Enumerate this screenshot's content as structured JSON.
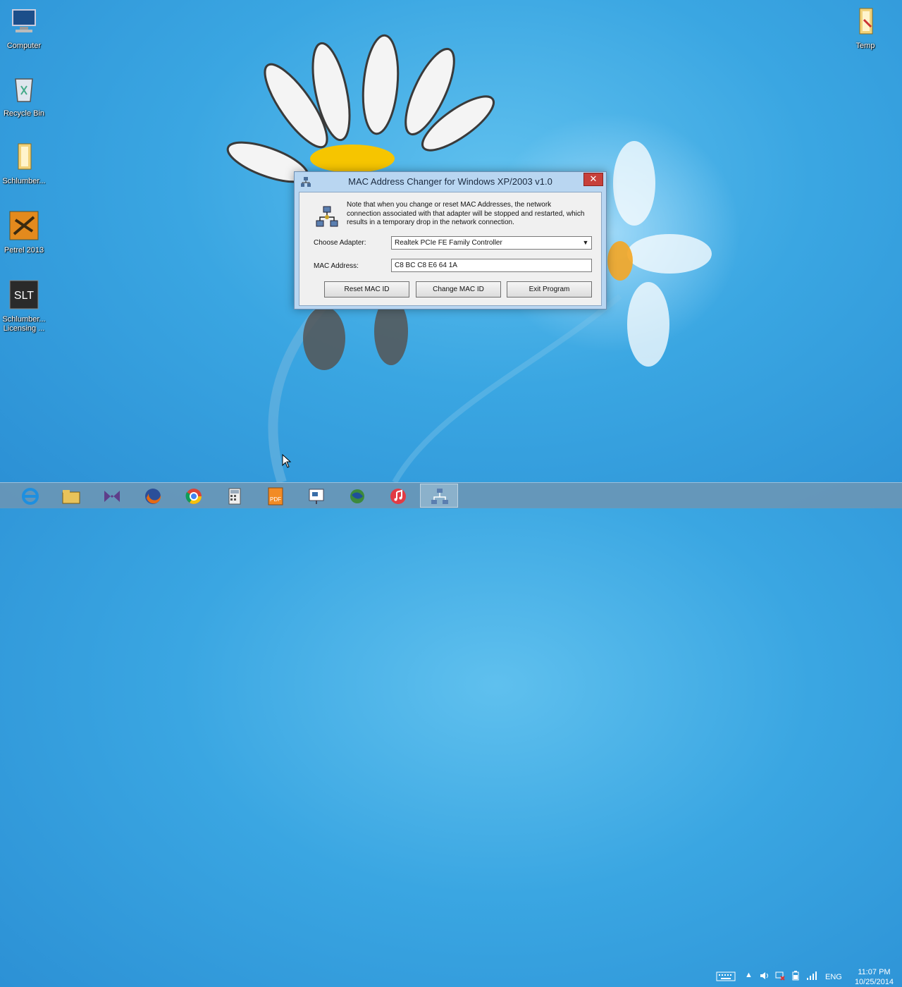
{
  "desktop": {
    "icons_left": [
      {
        "label": "Computer",
        "icon": "computer-icon"
      },
      {
        "label": "Recycle Bin",
        "icon": "recycle-bin-icon"
      },
      {
        "label": "Schlumber...",
        "icon": "folder-icon"
      },
      {
        "label": "Petrel 2013",
        "icon": "petrel-icon"
      },
      {
        "label": "Schlumber... Licensing ...",
        "icon": "slt-icon"
      }
    ],
    "icon_right": {
      "label": "Temp",
      "icon": "folder-icon"
    }
  },
  "dialog": {
    "title": "MAC Address Changer for Windows XP/2003 v1.0",
    "close_label": "✕",
    "note": "Note that when you change or reset MAC Addresses, the network connection associated with that adapter will be stopped and restarted, which results in a temporary drop in the network connection.",
    "adapter_label": "Choose Adapter:",
    "adapter_value": "Realtek PCIe FE Family Controller",
    "mac_label": "MAC Address:",
    "mac_value": "C8 BC C8 E6 64 1A",
    "buttons": {
      "reset": "Reset MAC ID",
      "change": "Change MAC ID",
      "exit": "Exit Program"
    }
  },
  "taskbar": {
    "items": [
      {
        "name": "internet-explorer-icon"
      },
      {
        "name": "file-explorer-icon"
      },
      {
        "name": "visual-studio-icon"
      },
      {
        "name": "firefox-icon"
      },
      {
        "name": "chrome-icon"
      },
      {
        "name": "calculator-icon"
      },
      {
        "name": "pdf-icon"
      },
      {
        "name": "presentation-icon"
      },
      {
        "name": "globe-icon"
      },
      {
        "name": "itunes-icon"
      },
      {
        "name": "mac-changer-icon",
        "active": true
      }
    ],
    "tray": {
      "language": "ENG",
      "time": "11:07 PM",
      "date": "10/25/2014"
    }
  }
}
